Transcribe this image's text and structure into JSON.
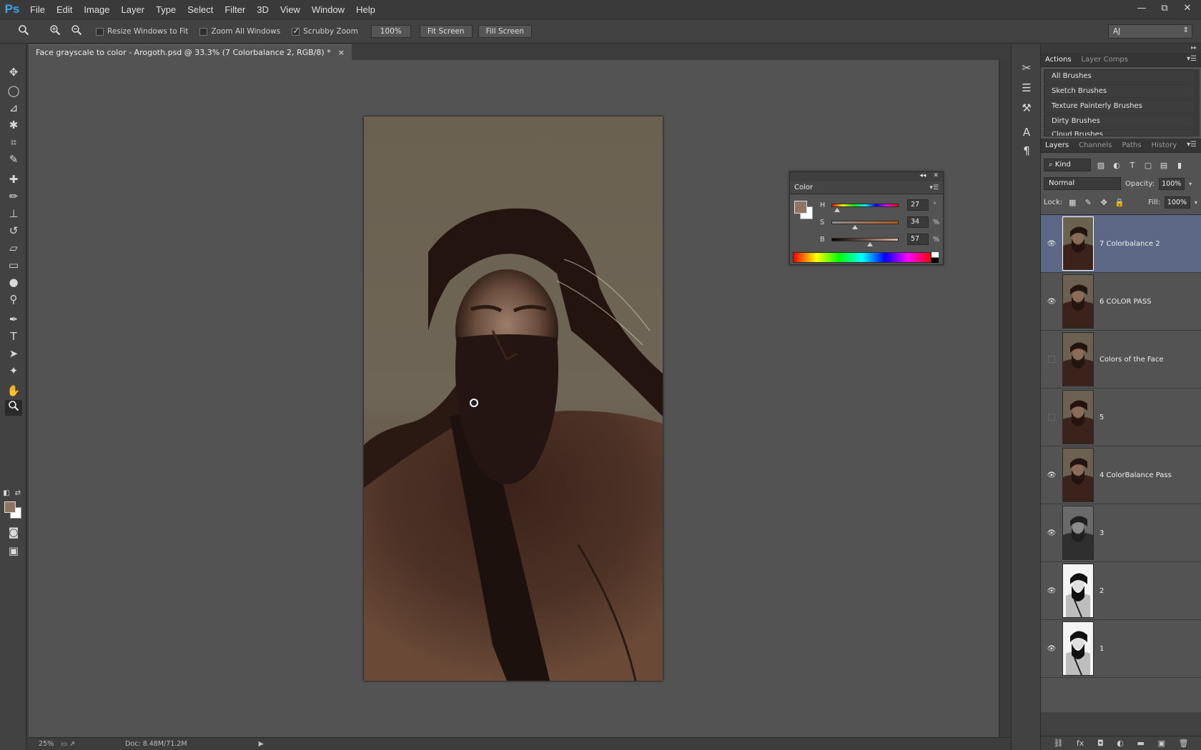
{
  "app": {
    "logo": "Ps"
  },
  "menu": [
    "File",
    "Edit",
    "Image",
    "Layer",
    "Type",
    "Select",
    "Filter",
    "3D",
    "View",
    "Window",
    "Help"
  ],
  "window_controls": {
    "minimize": "—",
    "restore": "⧉",
    "close": "✕"
  },
  "options_bar": {
    "resize_windows": "Resize Windows to Fit",
    "zoom_all": "Zoom All Windows",
    "scrubby_zoom": "Scrubby Zoom",
    "percent": "100%",
    "fit_screen": "Fit Screen",
    "fill_screen": "Fill Screen",
    "workspace": "AJ"
  },
  "document": {
    "tab_title": "Face grayscale to color - Arogoth.psd @ 33.3% (7 Colorbalance 2, RGB/8) *",
    "tab_close": "×"
  },
  "status": {
    "zoom": "25%",
    "doc": "Doc: 8.48M/71.2M",
    "arrow": "▶"
  },
  "color_panel": {
    "title": "Color",
    "fg_color": "#8f7462",
    "bg_color": "#ffffff",
    "h": {
      "label": "H",
      "value": "27",
      "unit": "°"
    },
    "s": {
      "label": "S",
      "value": "34",
      "unit": "%"
    },
    "b": {
      "label": "B",
      "value": "57",
      "unit": "%"
    }
  },
  "actions_panel": {
    "tabs": [
      "Actions",
      "Layer Comps"
    ],
    "items": [
      "All Brushes",
      "Sketch Brushes",
      "Texture Painterly Brushes",
      "Dirty Brushes",
      "Cloud Brushes"
    ]
  },
  "layers_panel": {
    "tabs": [
      "Layers",
      "Channels",
      "Paths",
      "History"
    ],
    "kind": "Kind",
    "blend_mode": "Normal",
    "opacity_label": "Opacity:",
    "opacity": "100%",
    "lock_label": "Lock:",
    "fill_label": "Fill:",
    "fill": "100%",
    "layers": [
      {
        "name": "7 Colorbalance 2",
        "visible": true,
        "selected": true,
        "thumb": "color"
      },
      {
        "name": "6 COLOR PASS",
        "visible": true,
        "selected": false,
        "thumb": "color"
      },
      {
        "name": "Colors of the Face",
        "visible": false,
        "selected": false,
        "thumb": "color"
      },
      {
        "name": "5",
        "visible": false,
        "selected": false,
        "thumb": "color"
      },
      {
        "name": "4 ColorBalance Pass",
        "visible": true,
        "selected": false,
        "thumb": "color"
      },
      {
        "name": "3",
        "visible": true,
        "selected": false,
        "thumb": "gray"
      },
      {
        "name": "2",
        "visible": true,
        "selected": false,
        "thumb": "bw"
      },
      {
        "name": "1",
        "visible": true,
        "selected": false,
        "thumb": "bw"
      }
    ],
    "footer_icons": [
      "link-icon",
      "fx-icon",
      "mask-icon",
      "adjustment-icon",
      "folder-icon",
      "new-layer-icon",
      "trash-icon"
    ]
  }
}
